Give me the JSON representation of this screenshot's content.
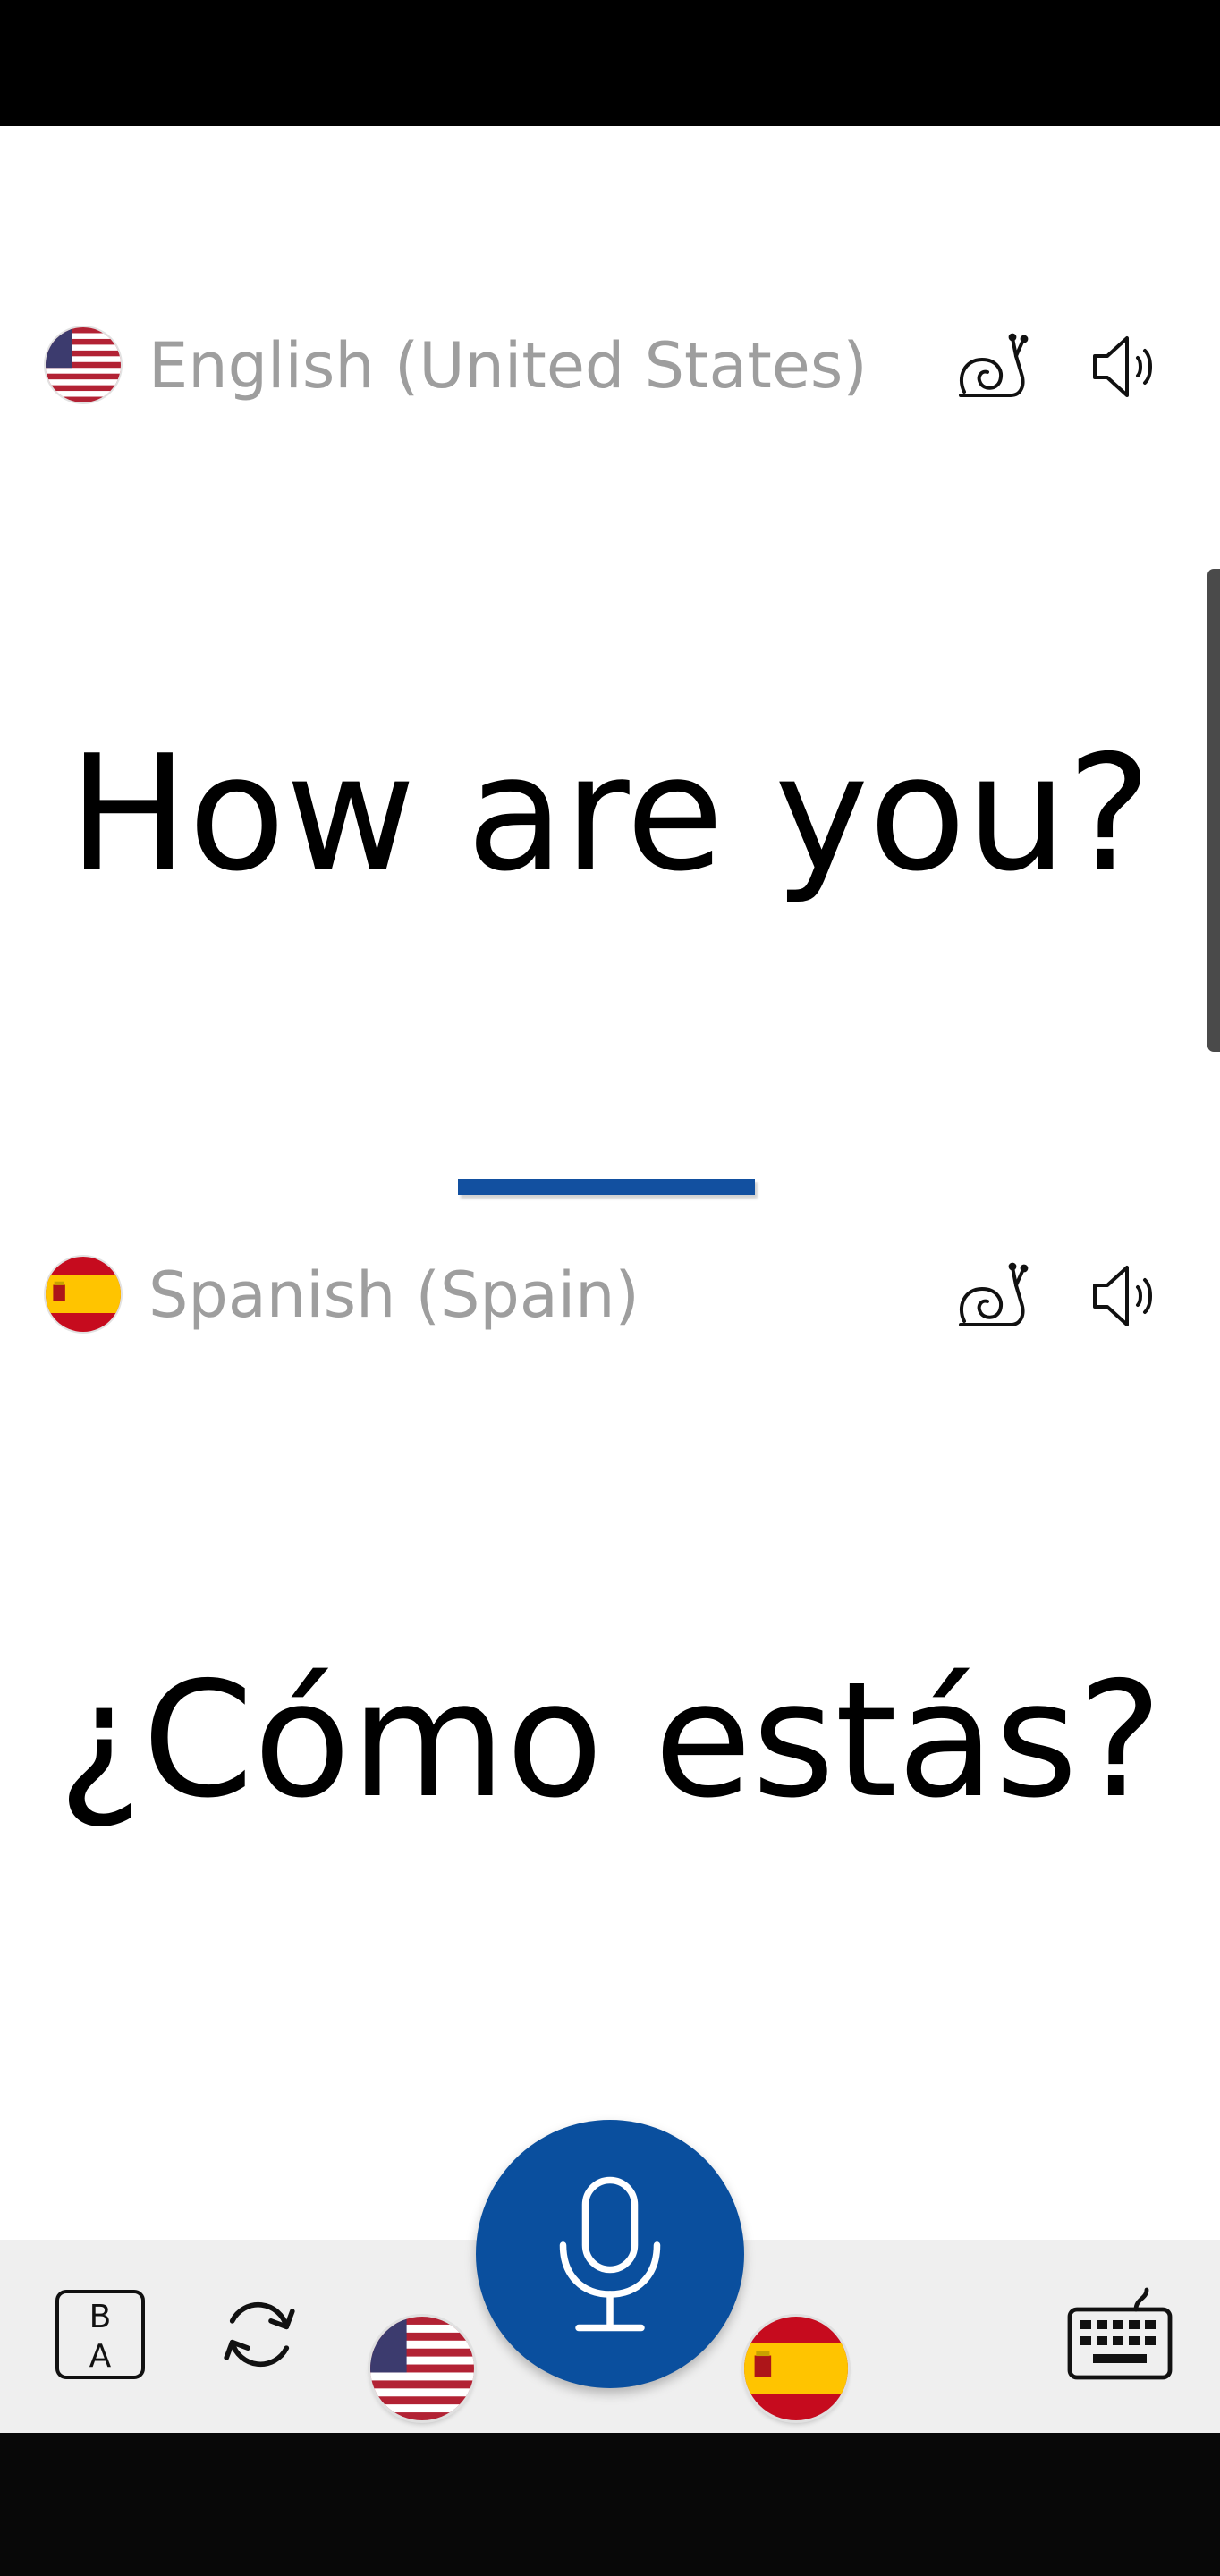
{
  "source_language": {
    "name": "English (United States)",
    "flag": "us-flag-icon",
    "phrase": "How are you?"
  },
  "target_language": {
    "name": "Spanish (Spain)",
    "flag": "spain-flag-icon",
    "phrase": "¿Cómo estás?"
  },
  "toolbar": {
    "swap_icon_top": "B",
    "swap_icon_bottom": "A",
    "icons": [
      "swap-languages-icon",
      "refresh-icon",
      "us-flag-icon",
      "microphone-icon",
      "spain-flag-icon",
      "keyboard-icon"
    ]
  },
  "colors": {
    "accent": "#0a4f9e",
    "divider": "#1250a0",
    "language_label": "#9e9e9e",
    "toolbar_bg": "#efefef"
  }
}
